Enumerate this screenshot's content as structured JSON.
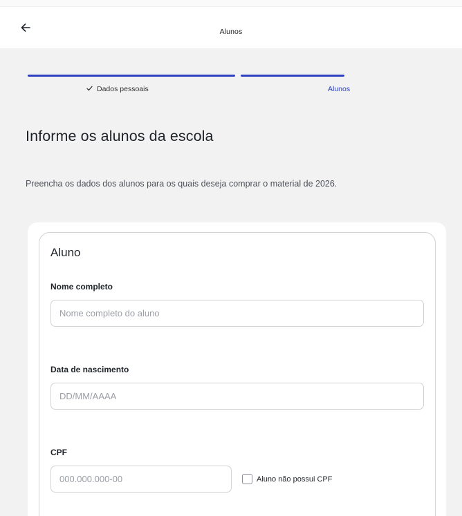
{
  "header": {
    "title": "Alunos",
    "back_icon": "arrow-left-icon"
  },
  "stepper": {
    "steps": [
      {
        "label": "Dados pessoais",
        "status": "completed",
        "icon": "check-icon"
      },
      {
        "label": "Alunos",
        "status": "current"
      }
    ],
    "accent_color": "#2c3fbe"
  },
  "main": {
    "heading": "Informe os alunos da escola",
    "description": "Preencha os dados dos alunos para os quais deseja comprar o material de 2026."
  },
  "student_form": {
    "title": "Aluno",
    "name": {
      "label": "Nome completo",
      "placeholder": "Nome completo do aluno",
      "value": ""
    },
    "birth_date": {
      "label": "Data de nascimento",
      "placeholder": "DD/MM/AAAA",
      "value": ""
    },
    "cpf": {
      "label": "CPF",
      "placeholder": "000.000.000-00",
      "value": "",
      "no_cpf_label": "Aluno não possui CPF",
      "no_cpf_checked": false
    }
  }
}
